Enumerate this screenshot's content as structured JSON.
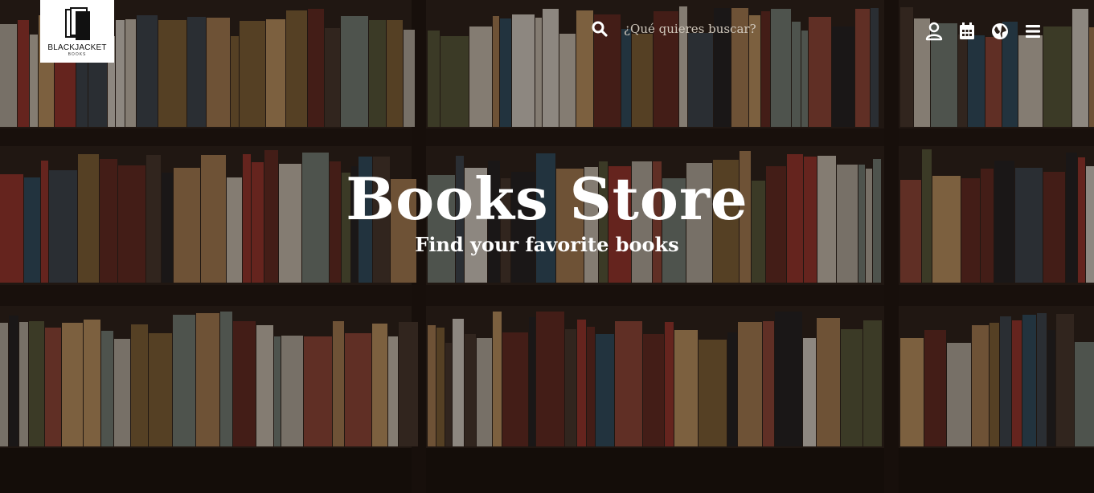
{
  "brand": {
    "name": "BLACKJACKET",
    "sub": "BOOKS"
  },
  "search": {
    "placeholder": "¿Qué quieres buscar?",
    "value": "",
    "icon": "search-icon"
  },
  "nav": {
    "icons": [
      "user-icon",
      "calendar-icon",
      "globe-icon",
      "hamburger-menu-icon"
    ]
  },
  "hero": {
    "title": "Books Store",
    "subtitle": "Find your favorite books"
  },
  "colors": {
    "text": "#ffffff",
    "overlay": "#140e0a",
    "logo_bg": "#ffffff"
  }
}
